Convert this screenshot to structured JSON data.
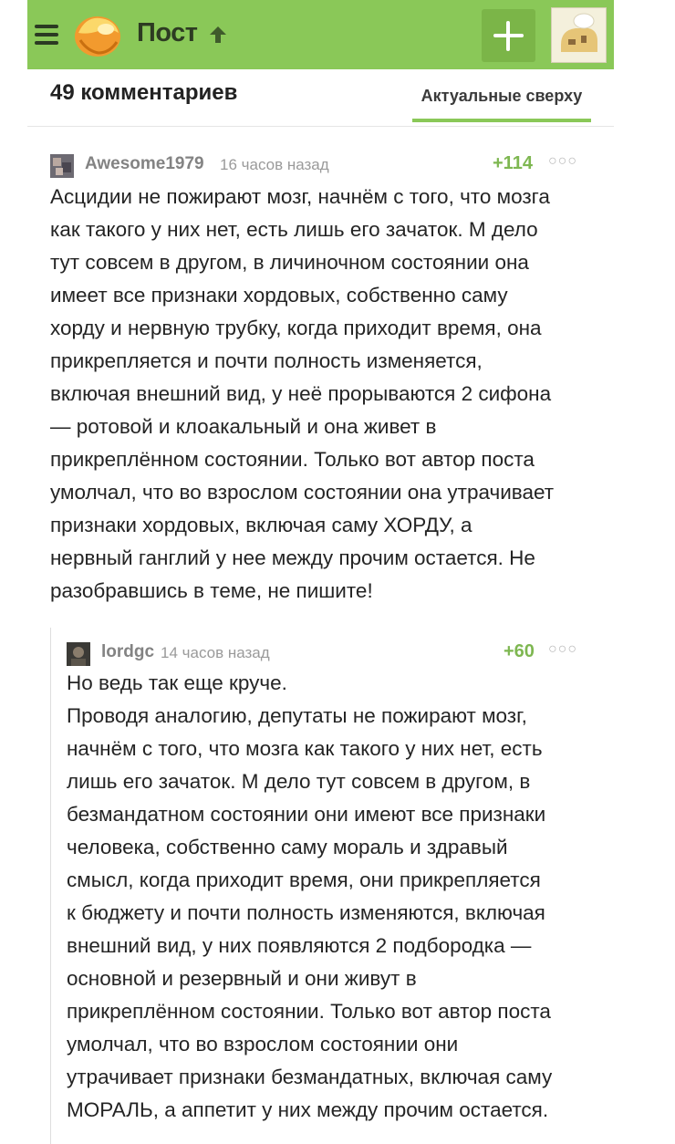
{
  "header": {
    "title": "Пост",
    "colors": {
      "bar": "#8ac858",
      "plus_button": "#7bb548",
      "text": "#2d3b22"
    }
  },
  "comments_bar": {
    "count_label": "49 комментариев",
    "sort_label": "Актуальные сверху"
  },
  "comments": [
    {
      "user": "Awesome1979",
      "time": "16 часов назад",
      "rating": "+114",
      "text": "Асцидии не пожирают мозг, начнём с того, что мозга\nкак такого у них нет, есть лишь его зачаток. М дело\nтут совсем в другом, в личиночном состоянии она\nимеет все признаки хордовых, собственно саму\nхорду и нервную трубку, когда приходит время, она\nприкрепляется и почти полность изменяется,\nвключая внешний вид, у неё прорываются 2 сифона\n— ротовой и клоакальный и она живет в\nприкреплённом состоянии. Только вот автор поста\nумолчал, что во взрослом состоянии она утрачивает\nпризнаки хордовых, включая саму ХОРДУ, а\nнервный ганглий у нее между прочим остается. Не\nразобравшись в теме, не пишите!"
    },
    {
      "user": "lordgc",
      "time": "14 часов назад",
      "rating": "+60",
      "text": "Но ведь так еще круче.\nПроводя аналогию, депутаты не пожирают мозг,\nначнём с того, что мозга как такого у них нет, есть\nлишь его зачаток. М дело тут совсем в другом, в\nбезмандатном состоянии они имеют все признаки\nчеловека, собственно саму мораль и здравый\nсмысл, когда приходит время, они прикрепляется\nк бюджету и почти полность изменяются, включая\nвнешний вид, у них появляются 2 подбородка —\nосновной и резервный и они живут в\nприкреплённом состоянии. Только вот автор поста\nумолчал, что во взрослом состоянии они\nутрачивает признаки безмандатных, включая саму\nМОРАЛЬ, а аппетит у них между прочим остается."
    }
  ],
  "icons": {
    "menu": "hamburger-menu-icon",
    "logo": "pikabu-logo-icon",
    "arrow": "arrow-up-icon",
    "add": "plus-icon",
    "user_avatar": "user-avatar-icon",
    "more": "more-dots-icon"
  }
}
